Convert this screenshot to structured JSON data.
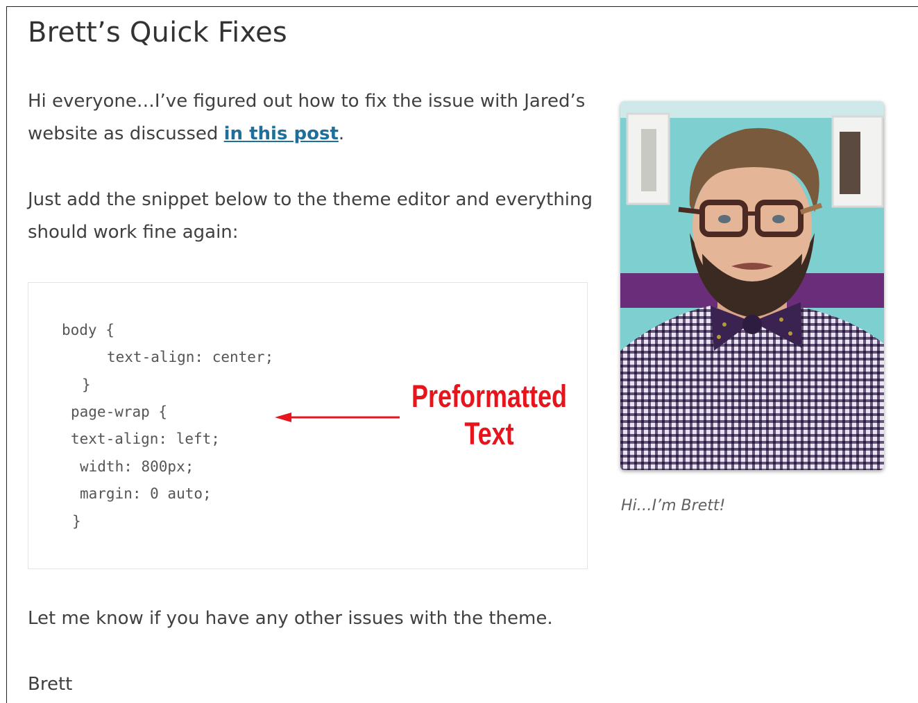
{
  "post": {
    "title": "Brett’s Quick Fixes",
    "intro_before_link": "Hi everyone…I’ve figured out how to fix the issue with Jared’s website as discussed ",
    "intro_link": "in this post",
    "intro_after_link": ".",
    "instructions": "Just add the snippet below to the theme editor and everything should work fine again:",
    "outro": "Let me know if you have any other issues with the theme.",
    "signature": "Brett"
  },
  "code": {
    "lines": [
      "body {",
      "text-align: center;",
      "}",
      "page-wrap {",
      "text-align: left;",
      "width: 800px;",
      "margin: 0 auto;",
      "}"
    ]
  },
  "annotation": {
    "line1": "Preformatted",
    "line2": "Text",
    "color": "#e8141c"
  },
  "sidebar": {
    "caption": "Hi…I’m Brett!"
  },
  "colors": {
    "link": "#1f6f9a",
    "text": "#404040"
  }
}
